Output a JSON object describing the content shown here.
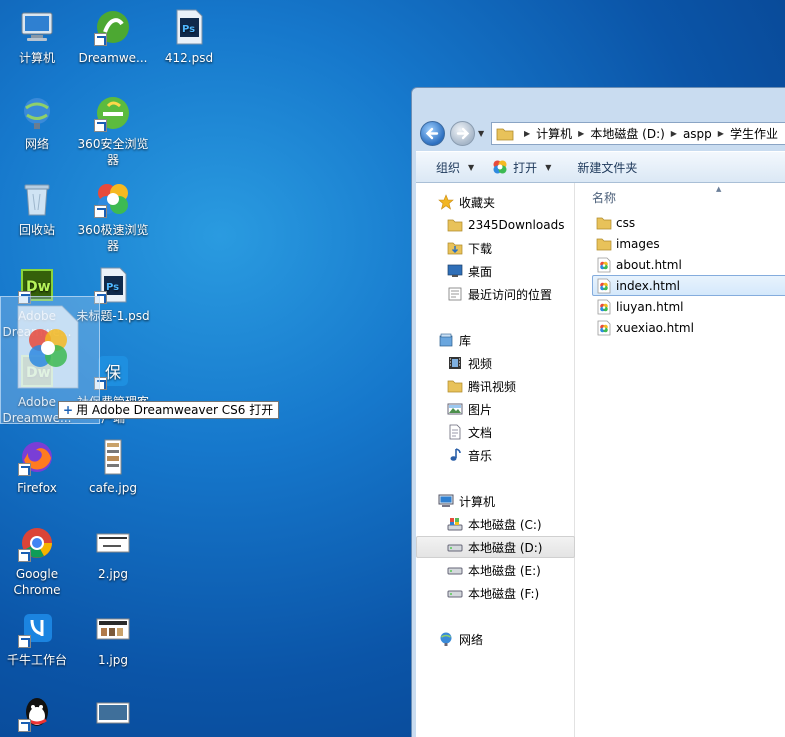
{
  "desktop_icons": [
    {
      "label": "计算机",
      "icon": "computer-icon"
    },
    {
      "label": "Dreamwe...",
      "icon": "dreamweaver-green-icon"
    },
    {
      "label": "412.psd",
      "icon": "psd-file-icon"
    },
    {
      "label": "网络",
      "icon": "network-icon"
    },
    {
      "label": "360安全浏览器",
      "icon": "360-safe-browser-icon"
    },
    {
      "label": "回收站",
      "icon": "recycle-bin-icon"
    },
    {
      "label": "360极速浏览器",
      "icon": "360-speed-browser-icon"
    },
    {
      "label": "Adobe Dreamwe...",
      "icon": "dreamweaver-icon"
    },
    {
      "label": "未标题-1.psd",
      "icon": "psd-file-icon"
    },
    {
      "label": "Adobe Dreamwe...",
      "icon": "dreamweaver-icon"
    },
    {
      "label": "社保费管理客户端",
      "icon": "shebao-client-icon"
    },
    {
      "label": "Firefox",
      "icon": "firefox-icon"
    },
    {
      "label": "cafe.jpg",
      "icon": "image-file-icon"
    },
    {
      "label": "Google Chrome",
      "icon": "chrome-icon"
    },
    {
      "label": "2.jpg",
      "icon": "image-file-icon"
    },
    {
      "label": "千牛工作台",
      "icon": "qianniu-icon"
    },
    {
      "label": "1.jpg",
      "icon": "image-file-icon"
    },
    {
      "label": "",
      "icon": "qq-icon"
    },
    {
      "label": "",
      "icon": "image-file-icon"
    }
  ],
  "drag_tooltip": "用 Adobe Dreamweaver CS6 打开",
  "explorer": {
    "breadcrumb": [
      "计算机",
      "本地磁盘 (D:)",
      "aspp",
      "学生作业"
    ],
    "toolbar": {
      "organize": "组织",
      "open": "打开",
      "new_folder": "新建文件夹"
    },
    "nav": {
      "favorites": "收藏夹",
      "favorites_items": [
        "2345Downloads",
        "下载",
        "桌面",
        "最近访问的位置"
      ],
      "libraries": "库",
      "library_items": [
        "视频",
        "腾讯视频",
        "图片",
        "文档",
        "音乐"
      ],
      "computer": "计算机",
      "drives": [
        "本地磁盘 (C:)",
        "本地磁盘 (D:)",
        "本地磁盘 (E:)",
        "本地磁盘 (F:)"
      ],
      "selected_drive": "本地磁盘 (D:)",
      "network": "网络"
    },
    "column_name": "名称",
    "files": [
      {
        "name": "css",
        "type": "folder"
      },
      {
        "name": "images",
        "type": "folder"
      },
      {
        "name": "about.html",
        "type": "html"
      },
      {
        "name": "index.html",
        "type": "html"
      },
      {
        "name": "liuyan.html",
        "type": "html"
      },
      {
        "name": "xuexiao.html",
        "type": "html"
      }
    ],
    "selected_file": "index.html"
  },
  "colors": {
    "desktop_blue": "#1678cc",
    "selection_blue": "#84acdd",
    "folder_yellow": "#e8c25a"
  }
}
